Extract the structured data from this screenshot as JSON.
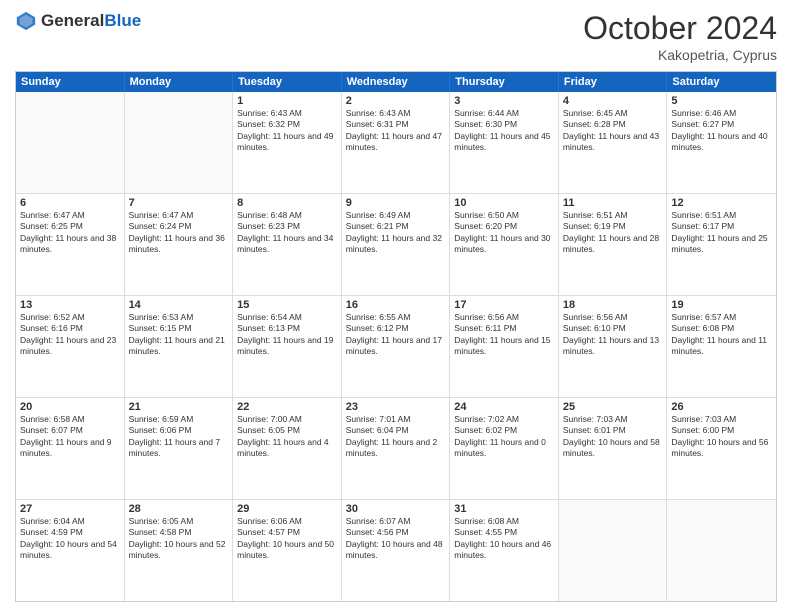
{
  "header": {
    "logo": {
      "general": "General",
      "blue": "Blue"
    },
    "title": "October 2024",
    "location": "Kakopetria, Cyprus"
  },
  "days_of_week": [
    "Sunday",
    "Monday",
    "Tuesday",
    "Wednesday",
    "Thursday",
    "Friday",
    "Saturday"
  ],
  "rows": [
    [
      {
        "day": "",
        "empty": true
      },
      {
        "day": "",
        "empty": true
      },
      {
        "day": "1",
        "sunrise": "Sunrise: 6:43 AM",
        "sunset": "Sunset: 6:32 PM",
        "daylight": "Daylight: 11 hours and 49 minutes."
      },
      {
        "day": "2",
        "sunrise": "Sunrise: 6:43 AM",
        "sunset": "Sunset: 6:31 PM",
        "daylight": "Daylight: 11 hours and 47 minutes."
      },
      {
        "day": "3",
        "sunrise": "Sunrise: 6:44 AM",
        "sunset": "Sunset: 6:30 PM",
        "daylight": "Daylight: 11 hours and 45 minutes."
      },
      {
        "day": "4",
        "sunrise": "Sunrise: 6:45 AM",
        "sunset": "Sunset: 6:28 PM",
        "daylight": "Daylight: 11 hours and 43 minutes."
      },
      {
        "day": "5",
        "sunrise": "Sunrise: 6:46 AM",
        "sunset": "Sunset: 6:27 PM",
        "daylight": "Daylight: 11 hours and 40 minutes."
      }
    ],
    [
      {
        "day": "6",
        "sunrise": "Sunrise: 6:47 AM",
        "sunset": "Sunset: 6:25 PM",
        "daylight": "Daylight: 11 hours and 38 minutes."
      },
      {
        "day": "7",
        "sunrise": "Sunrise: 6:47 AM",
        "sunset": "Sunset: 6:24 PM",
        "daylight": "Daylight: 11 hours and 36 minutes."
      },
      {
        "day": "8",
        "sunrise": "Sunrise: 6:48 AM",
        "sunset": "Sunset: 6:23 PM",
        "daylight": "Daylight: 11 hours and 34 minutes."
      },
      {
        "day": "9",
        "sunrise": "Sunrise: 6:49 AM",
        "sunset": "Sunset: 6:21 PM",
        "daylight": "Daylight: 11 hours and 32 minutes."
      },
      {
        "day": "10",
        "sunrise": "Sunrise: 6:50 AM",
        "sunset": "Sunset: 6:20 PM",
        "daylight": "Daylight: 11 hours and 30 minutes."
      },
      {
        "day": "11",
        "sunrise": "Sunrise: 6:51 AM",
        "sunset": "Sunset: 6:19 PM",
        "daylight": "Daylight: 11 hours and 28 minutes."
      },
      {
        "day": "12",
        "sunrise": "Sunrise: 6:51 AM",
        "sunset": "Sunset: 6:17 PM",
        "daylight": "Daylight: 11 hours and 25 minutes."
      }
    ],
    [
      {
        "day": "13",
        "sunrise": "Sunrise: 6:52 AM",
        "sunset": "Sunset: 6:16 PM",
        "daylight": "Daylight: 11 hours and 23 minutes."
      },
      {
        "day": "14",
        "sunrise": "Sunrise: 6:53 AM",
        "sunset": "Sunset: 6:15 PM",
        "daylight": "Daylight: 11 hours and 21 minutes."
      },
      {
        "day": "15",
        "sunrise": "Sunrise: 6:54 AM",
        "sunset": "Sunset: 6:13 PM",
        "daylight": "Daylight: 11 hours and 19 minutes."
      },
      {
        "day": "16",
        "sunrise": "Sunrise: 6:55 AM",
        "sunset": "Sunset: 6:12 PM",
        "daylight": "Daylight: 11 hours and 17 minutes."
      },
      {
        "day": "17",
        "sunrise": "Sunrise: 6:56 AM",
        "sunset": "Sunset: 6:11 PM",
        "daylight": "Daylight: 11 hours and 15 minutes."
      },
      {
        "day": "18",
        "sunrise": "Sunrise: 6:56 AM",
        "sunset": "Sunset: 6:10 PM",
        "daylight": "Daylight: 11 hours and 13 minutes."
      },
      {
        "day": "19",
        "sunrise": "Sunrise: 6:57 AM",
        "sunset": "Sunset: 6:08 PM",
        "daylight": "Daylight: 11 hours and 11 minutes."
      }
    ],
    [
      {
        "day": "20",
        "sunrise": "Sunrise: 6:58 AM",
        "sunset": "Sunset: 6:07 PM",
        "daylight": "Daylight: 11 hours and 9 minutes."
      },
      {
        "day": "21",
        "sunrise": "Sunrise: 6:59 AM",
        "sunset": "Sunset: 6:06 PM",
        "daylight": "Daylight: 11 hours and 7 minutes."
      },
      {
        "day": "22",
        "sunrise": "Sunrise: 7:00 AM",
        "sunset": "Sunset: 6:05 PM",
        "daylight": "Daylight: 11 hours and 4 minutes."
      },
      {
        "day": "23",
        "sunrise": "Sunrise: 7:01 AM",
        "sunset": "Sunset: 6:04 PM",
        "daylight": "Daylight: 11 hours and 2 minutes."
      },
      {
        "day": "24",
        "sunrise": "Sunrise: 7:02 AM",
        "sunset": "Sunset: 6:02 PM",
        "daylight": "Daylight: 11 hours and 0 minutes."
      },
      {
        "day": "25",
        "sunrise": "Sunrise: 7:03 AM",
        "sunset": "Sunset: 6:01 PM",
        "daylight": "Daylight: 10 hours and 58 minutes."
      },
      {
        "day": "26",
        "sunrise": "Sunrise: 7:03 AM",
        "sunset": "Sunset: 6:00 PM",
        "daylight": "Daylight: 10 hours and 56 minutes."
      }
    ],
    [
      {
        "day": "27",
        "sunrise": "Sunrise: 6:04 AM",
        "sunset": "Sunset: 4:59 PM",
        "daylight": "Daylight: 10 hours and 54 minutes."
      },
      {
        "day": "28",
        "sunrise": "Sunrise: 6:05 AM",
        "sunset": "Sunset: 4:58 PM",
        "daylight": "Daylight: 10 hours and 52 minutes."
      },
      {
        "day": "29",
        "sunrise": "Sunrise: 6:06 AM",
        "sunset": "Sunset: 4:57 PM",
        "daylight": "Daylight: 10 hours and 50 minutes."
      },
      {
        "day": "30",
        "sunrise": "Sunrise: 6:07 AM",
        "sunset": "Sunset: 4:56 PM",
        "daylight": "Daylight: 10 hours and 48 minutes."
      },
      {
        "day": "31",
        "sunrise": "Sunrise: 6:08 AM",
        "sunset": "Sunset: 4:55 PM",
        "daylight": "Daylight: 10 hours and 46 minutes."
      },
      {
        "day": "",
        "empty": true
      },
      {
        "day": "",
        "empty": true
      }
    ]
  ]
}
